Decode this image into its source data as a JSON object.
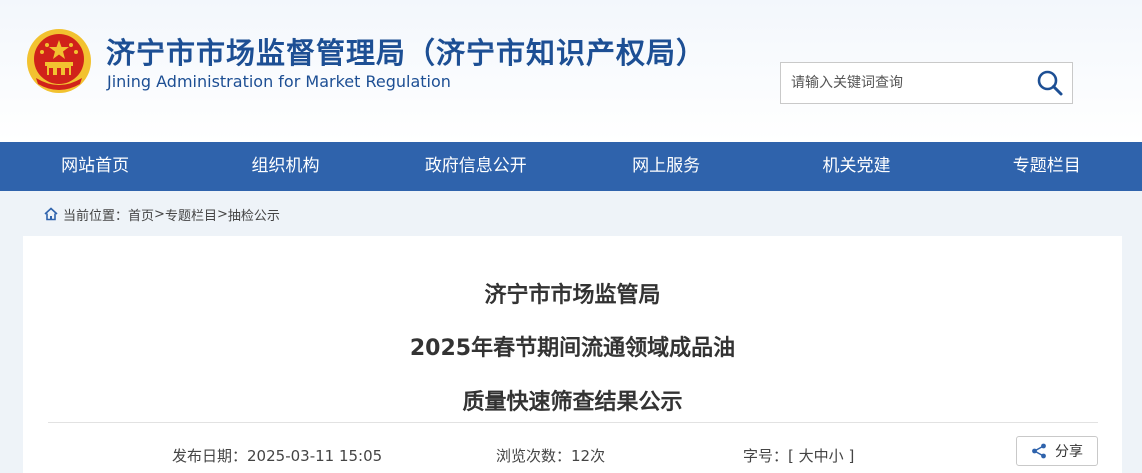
{
  "header": {
    "title": "济宁市市场监督管理局（济宁市知识产权局）",
    "subtitle": "Jining Administration for Market Regulation",
    "emblem_icon": "national-emblem-icon"
  },
  "search": {
    "placeholder": "请输入关键词查询",
    "value": "",
    "icon": "search-icon"
  },
  "nav": {
    "items": [
      {
        "label": "网站首页"
      },
      {
        "label": "组织机构"
      },
      {
        "label": "政府信息公开"
      },
      {
        "label": "网上服务"
      },
      {
        "label": "机关党建"
      },
      {
        "label": "专题栏目"
      }
    ],
    "color": "#2f63ac"
  },
  "breadcrumb": {
    "prefix": "当前位置：",
    "home": "首页",
    "sep1": "> ",
    "section": "专题栏目",
    "sep2": "> ",
    "current": "抽检公示"
  },
  "article": {
    "title_line1": "济宁市市场监管局",
    "title_line2": "2025年春节期间流通领域成品油",
    "title_line3": "质量快速筛查结果公示",
    "publish_label": "发布日期：",
    "publish_date": "2025-03-11 15:05",
    "views_label": "浏览次数：",
    "views": "12次",
    "font_size_label": "字号：",
    "font_size_open": "[ ",
    "font_large": "大",
    "font_medium": "中",
    "font_small": "小",
    "font_size_close": " ]",
    "share_label": "分享"
  },
  "colors": {
    "brand_blue": "#1d4f94",
    "nav_blue": "#2f63ac",
    "emblem_red": "#d0221a",
    "emblem_gold": "#f2c230"
  }
}
